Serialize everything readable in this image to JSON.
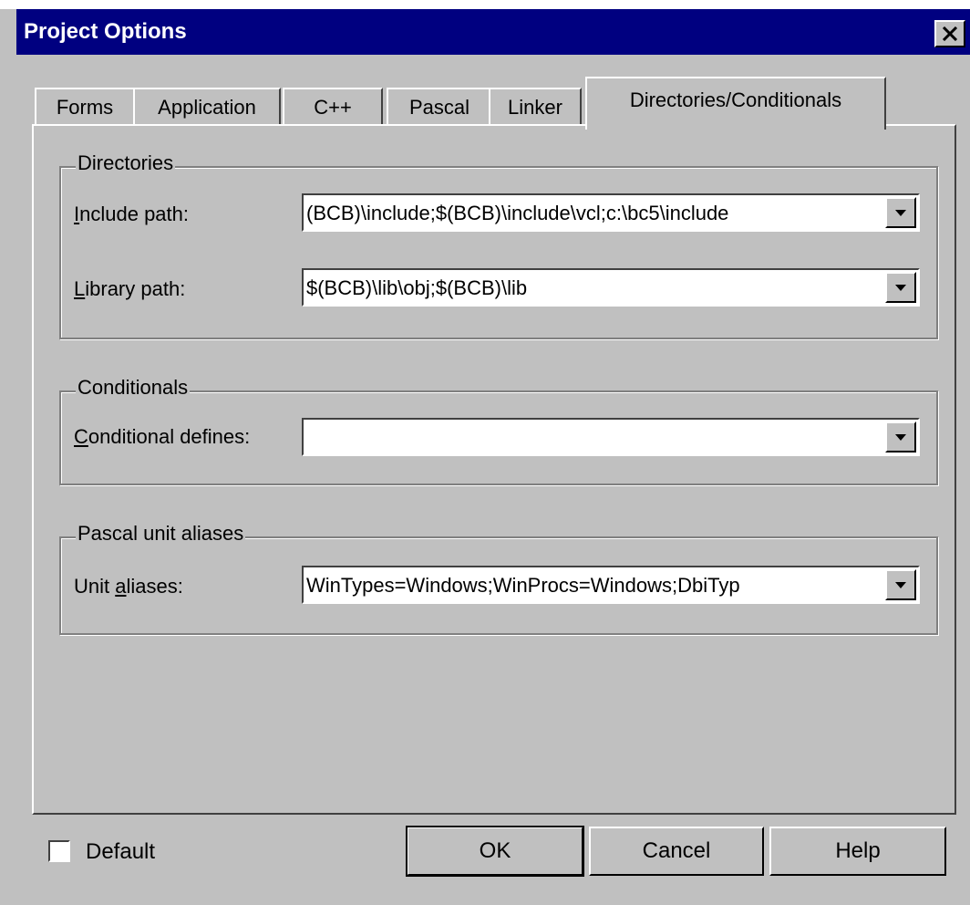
{
  "window": {
    "title": "Project Options"
  },
  "tabs": [
    {
      "label": "Forms"
    },
    {
      "label": "Application"
    },
    {
      "label": "C++"
    },
    {
      "label": "Pascal"
    },
    {
      "label": "Linker"
    },
    {
      "label": "Directories/Conditionals",
      "active": true
    }
  ],
  "directories": {
    "group_label": "Directories",
    "include": {
      "label_underline": "I",
      "label_rest": "nclude path:",
      "value": "(BCB)\\include;$(BCB)\\include\\vcl;c:\\bc5\\include"
    },
    "library": {
      "label_underline": "L",
      "label_rest": "ibrary path:",
      "value": "$(BCB)\\lib\\obj;$(BCB)\\lib"
    }
  },
  "conditionals": {
    "group_label": "Conditionals",
    "defines": {
      "label_underline": "C",
      "label_rest": "onditional defines:",
      "value": ""
    }
  },
  "aliases": {
    "group_label": "Pascal unit aliases",
    "unit": {
      "label_pre": "Unit ",
      "label_underline": "a",
      "label_rest": "liases:",
      "value": "WinTypes=Windows;WinProcs=Windows;DbiTyp"
    }
  },
  "footer": {
    "default_label": "Default",
    "default_checked": false,
    "ok_label": "OK",
    "cancel_label": "Cancel",
    "help_label": "Help"
  }
}
